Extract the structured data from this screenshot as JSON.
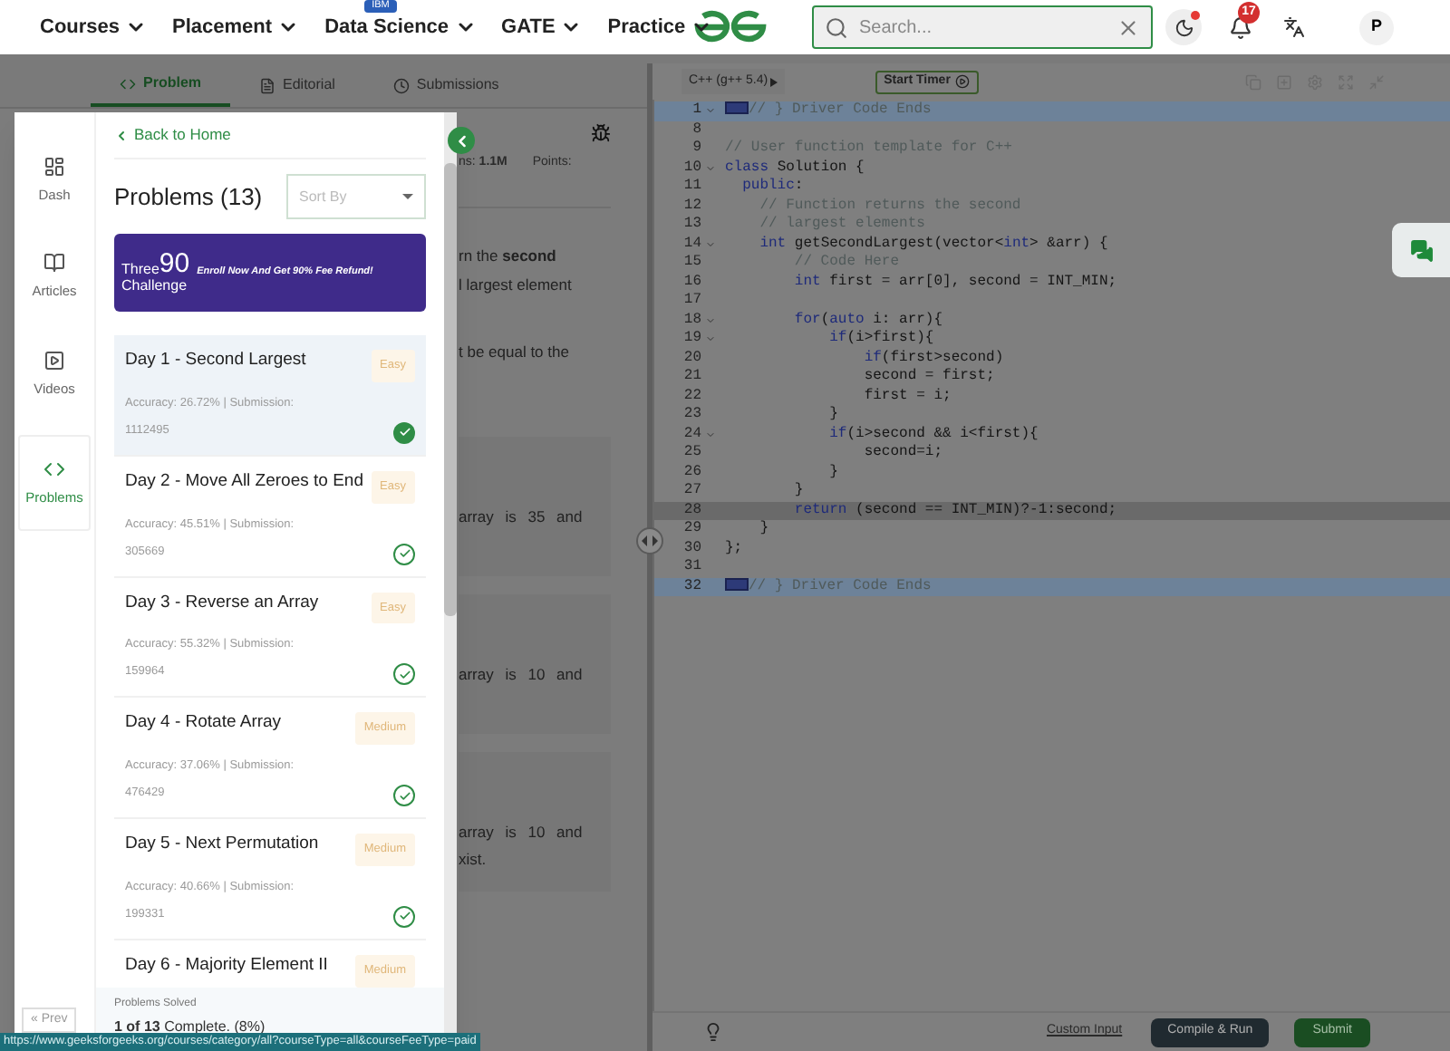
{
  "nav": {
    "menus": [
      {
        "label": "Courses"
      },
      {
        "label": "Placement"
      },
      {
        "label": "Data Science",
        "badge": "IBM"
      },
      {
        "label": "GATE"
      },
      {
        "label": "Practice"
      }
    ],
    "search": {
      "placeholder": "Search..."
    },
    "notifications": "17",
    "avatar": "P"
  },
  "problem": {
    "tabs": [
      {
        "label": "Problem",
        "selected": true
      },
      {
        "label": "Editorial",
        "selected": false
      },
      {
        "label": "Submissions",
        "selected": false
      }
    ],
    "stats": [
      "ns: **1.1M**",
      "Points:"
    ],
    "paragraphs": [
      [
        "rn the **second**",
        "l largest element"
      ],
      [
        "t be equal to the"
      ]
    ],
    "examples": [
      [
        "array is 35 and"
      ],
      [
        "array is 10 and"
      ],
      [
        "array is 10 and",
        "xist."
      ]
    ]
  },
  "editor": {
    "language": "C++ (g++ 5.4)",
    "timer": "Start Timer",
    "lines": [
      {
        "number": "1",
        "fold": true,
        "selected": true,
        "active": false,
        "tokens": [
          {
            "kind": "marker"
          },
          {
            "kind": "comment",
            "text": "// } Driver Code Ends"
          }
        ]
      },
      {
        "number": "8",
        "fold": false,
        "selected": false,
        "active": false
      },
      {
        "number": "9",
        "fold": false,
        "selected": false,
        "active": false,
        "tokens": [
          {
            "kind": "comment",
            "text": "// User function template for C++"
          }
        ]
      },
      {
        "number": "10",
        "fold": true,
        "selected": false,
        "active": false,
        "tokens": [
          {
            "kind": "keyword",
            "text": "class"
          },
          {
            "kind": "plain",
            "text": " Solution {"
          }
        ]
      },
      {
        "number": "11",
        "fold": false,
        "selected": false,
        "active": false,
        "tokens": [
          {
            "kind": "keyword",
            "text": "  public"
          },
          {
            "kind": "plain",
            "text": ":"
          }
        ]
      },
      {
        "number": "12",
        "fold": false,
        "selected": false,
        "active": false,
        "tokens": [
          {
            "kind": "comment",
            "text": "    // Function returns the second"
          }
        ]
      },
      {
        "number": "13",
        "fold": false,
        "selected": false,
        "active": false,
        "tokens": [
          {
            "kind": "comment",
            "text": "    // largest elements"
          }
        ]
      },
      {
        "number": "14",
        "fold": true,
        "selected": false,
        "active": false,
        "tokens": [
          {
            "kind": "keyword",
            "text": "    int"
          },
          {
            "kind": "plain",
            "text": " getSecondLargest(vector<"
          },
          {
            "kind": "keyword",
            "text": "int"
          },
          {
            "kind": "plain",
            "text": "> &arr) {"
          }
        ]
      },
      {
        "number": "15",
        "fold": false,
        "selected": false,
        "active": false,
        "tokens": [
          {
            "kind": "comment",
            "text": "        // Code Here"
          }
        ]
      },
      {
        "number": "16",
        "fold": false,
        "selected": false,
        "active": false,
        "tokens": [
          {
            "kind": "keyword",
            "text": "        int"
          },
          {
            "kind": "plain",
            "text": " first = arr[0], second = INT_MIN;"
          }
        ]
      },
      {
        "number": "17",
        "fold": false,
        "selected": false,
        "active": false
      },
      {
        "number": "18",
        "fold": true,
        "selected": false,
        "active": false,
        "tokens": [
          {
            "kind": "keyword",
            "text": "        for"
          },
          {
            "kind": "plain",
            "text": "("
          },
          {
            "kind": "keyword",
            "text": "auto"
          },
          {
            "kind": "plain",
            "text": " i: arr){"
          }
        ]
      },
      {
        "number": "19",
        "fold": true,
        "selected": false,
        "active": false,
        "tokens": [
          {
            "kind": "keyword",
            "text": "            if"
          },
          {
            "kind": "plain",
            "text": "(i>first){"
          }
        ]
      },
      {
        "number": "20",
        "fold": false,
        "selected": false,
        "active": false,
        "tokens": [
          {
            "kind": "keyword",
            "text": "                if"
          },
          {
            "kind": "plain",
            "text": "(first>second)"
          }
        ]
      },
      {
        "number": "21",
        "fold": false,
        "selected": false,
        "active": false,
        "tokens": [
          {
            "kind": "plain",
            "text": "                second = first;"
          }
        ]
      },
      {
        "number": "22",
        "fold": false,
        "selected": false,
        "active": false,
        "tokens": [
          {
            "kind": "plain",
            "text": "                first = i;"
          }
        ]
      },
      {
        "number": "23",
        "fold": false,
        "selected": false,
        "active": false,
        "tokens": [
          {
            "kind": "plain",
            "text": "            }"
          }
        ]
      },
      {
        "number": "24",
        "fold": true,
        "selected": false,
        "active": false,
        "tokens": [
          {
            "kind": "keyword",
            "text": "            if"
          },
          {
            "kind": "plain",
            "text": "(i>second && i<first){"
          }
        ]
      },
      {
        "number": "25",
        "fold": false,
        "selected": false,
        "active": false,
        "tokens": [
          {
            "kind": "plain",
            "text": "                second=i;"
          }
        ]
      },
      {
        "number": "26",
        "fold": false,
        "selected": false,
        "active": false,
        "tokens": [
          {
            "kind": "plain",
            "text": "            }"
          }
        ]
      },
      {
        "number": "27",
        "fold": false,
        "selected": false,
        "active": false,
        "tokens": [
          {
            "kind": "plain",
            "text": "        }"
          }
        ]
      },
      {
        "number": "28",
        "fold": false,
        "selected": false,
        "active": true,
        "tokens": [
          {
            "kind": "keyword",
            "text": "        return"
          },
          {
            "kind": "plain",
            "text": " (second == INT_MIN)?-1:second;"
          }
        ]
      },
      {
        "number": "29",
        "fold": false,
        "selected": false,
        "active": false,
        "tokens": [
          {
            "kind": "plain",
            "text": "    }"
          }
        ]
      },
      {
        "number": "30",
        "fold": false,
        "selected": false,
        "active": false,
        "tokens": [
          {
            "kind": "plain",
            "text": "};"
          }
        ]
      },
      {
        "number": "31",
        "fold": false,
        "selected": false,
        "active": false
      },
      {
        "number": "32",
        "fold": false,
        "selected": true,
        "active": false,
        "tokens": [
          {
            "kind": "marker"
          },
          {
            "kind": "comment",
            "text": "// } Driver Code Ends"
          }
        ]
      }
    ],
    "custom_input": "Custom Input",
    "compile": "Compile & Run",
    "submit": "Submit"
  },
  "drawer": {
    "nav": [
      {
        "label": "Dash",
        "selected": false
      },
      {
        "label": "Articles",
        "selected": false
      },
      {
        "label": "Videos",
        "selected": false
      },
      {
        "label": "Problems",
        "selected": true
      }
    ],
    "prev": "« Prev",
    "back": "Back to Home",
    "title": "Problems (13)",
    "sort": {
      "placeholder": "Sort By"
    },
    "banner": {
      "word": "Three",
      "number": "90",
      "word2": "Challenge",
      "tagline": "Enroll Now And Get 90% Fee Refund!"
    },
    "problems": [
      {
        "title": "Day 1 - Second Largest",
        "difficulty": "Easy",
        "stats": "Accuracy: 26.72% | Submission: 1112495",
        "selected": true
      },
      {
        "title": "Day 2 - Move All Zeroes to End",
        "difficulty": "Easy",
        "stats": "Accuracy: 45.51% | Submission: 305669",
        "selected": false
      },
      {
        "title": "Day 3 - Reverse an Array",
        "difficulty": "Easy",
        "stats": "Accuracy: 55.32% | Submission: 159964",
        "selected": false
      },
      {
        "title": "Day 4 - Rotate Array",
        "difficulty": "Medium",
        "stats": "Accuracy: 37.06% | Submission: 476429",
        "selected": false
      },
      {
        "title": "Day 5 - Next Permutation",
        "difficulty": "Medium",
        "stats": "Accuracy: 40.66% | Submission: 199331",
        "selected": false
      },
      {
        "title": "Day 6 - Majority Element II",
        "difficulty": "Medium",
        "selected": false
      }
    ],
    "summary_label": "Problems Solved",
    "summary": "**1 of 13** Complete. (8%)"
  },
  "status_url": "https://www.geeksforgeeks.org/courses/category/all?courseType=all&courseFeeType=paid"
}
